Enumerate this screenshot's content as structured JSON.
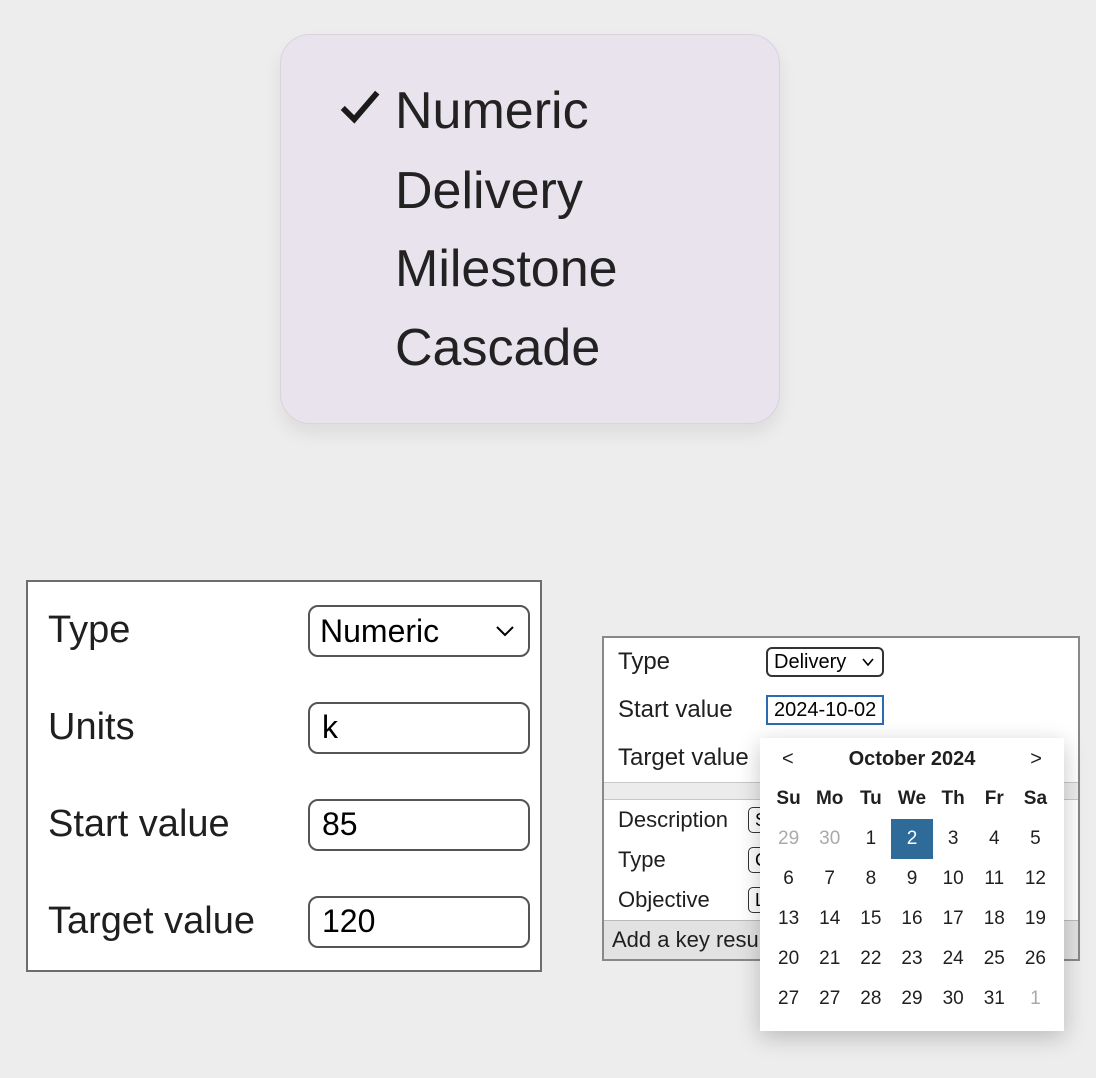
{
  "dropdown": {
    "options": [
      {
        "label": "Numeric",
        "selected": true
      },
      {
        "label": "Delivery",
        "selected": false
      },
      {
        "label": "Milestone",
        "selected": false
      },
      {
        "label": "Cascade",
        "selected": false
      }
    ]
  },
  "left_form": {
    "type_label": "Type",
    "type_value": "Numeric",
    "units_label": "Units",
    "units_value": "k",
    "start_label": "Start value",
    "start_value": "85",
    "target_label": "Target value",
    "target_value": "120"
  },
  "right_form": {
    "type_label": "Type",
    "type_value": "Delivery",
    "start_label": "Start value",
    "start_value": "2024-10-02",
    "target_label": "Target value",
    "target_value": "",
    "description_label": "Description",
    "description_value": "S",
    "type2_label": "Type",
    "type2_value": "C",
    "objective_label": "Objective",
    "objective_value": "L",
    "footer": "Add a key result"
  },
  "calendar": {
    "prev_label": "<",
    "next_label": ">",
    "month_label": "October 2024",
    "weekdays": [
      "Su",
      "Mo",
      "Tu",
      "We",
      "Th",
      "Fr",
      "Sa"
    ],
    "weeks": [
      [
        {
          "d": 29,
          "other": true
        },
        {
          "d": 30,
          "other": true
        },
        {
          "d": 1
        },
        {
          "d": 2,
          "selected": true
        },
        {
          "d": 3
        },
        {
          "d": 4
        },
        {
          "d": 5
        }
      ],
      [
        {
          "d": 6
        },
        {
          "d": 7
        },
        {
          "d": 8
        },
        {
          "d": 9
        },
        {
          "d": 10
        },
        {
          "d": 11
        },
        {
          "d": 12
        }
      ],
      [
        {
          "d": 13
        },
        {
          "d": 14
        },
        {
          "d": 15
        },
        {
          "d": 16
        },
        {
          "d": 17
        },
        {
          "d": 18
        },
        {
          "d": 19
        }
      ],
      [
        {
          "d": 20
        },
        {
          "d": 21
        },
        {
          "d": 22
        },
        {
          "d": 23
        },
        {
          "d": 24
        },
        {
          "d": 25
        },
        {
          "d": 26
        }
      ],
      [
        {
          "d": 27
        },
        {
          "d": 27
        },
        {
          "d": 28
        },
        {
          "d": 29
        },
        {
          "d": 30
        },
        {
          "d": 31
        },
        {
          "d": 1,
          "other": true
        }
      ]
    ]
  }
}
